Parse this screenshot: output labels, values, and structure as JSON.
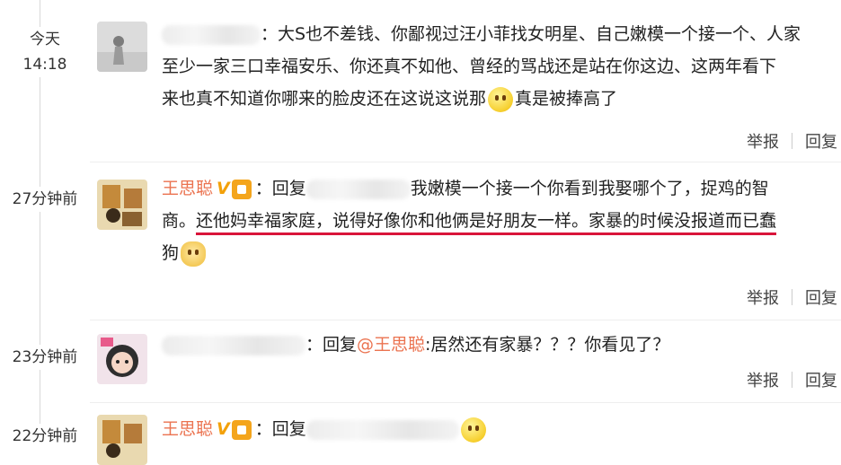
{
  "comments": [
    {
      "time": [
        "今天",
        "14:18"
      ],
      "text_lines": [
        "：大S也不差钱、你鄙视过汪小菲找女明星、自己嫩模一个接一个、人家",
        "至少一家三口幸福安乐、你还真不如他、曾经的骂战还是站在你这边、这两年看下",
        "来也真不知道你哪来的脸皮还在这说这说那",
        "真是被捧高了"
      ],
      "actions": [
        "举报",
        "回复"
      ]
    },
    {
      "time": [
        "27分钟前"
      ],
      "username": "王思聪",
      "vip": "V",
      "reply_prefix": "：回复",
      "text_lines": [
        "我嫩模一个接一个你看到我娶哪个了，捉鸡的智",
        "商。",
        "还他妈幸福家庭，说得好像你和他俩是好朋友一样。家暴的时候没报道而已蠢",
        "狗"
      ],
      "actions": [
        "举报",
        "回复"
      ]
    },
    {
      "time": [
        "23分钟前"
      ],
      "text_lines": [
        "：回复",
        "@王思聪",
        ":居然还有家暴？？？你看见了？"
      ],
      "actions": [
        "举报",
        "回复"
      ]
    },
    {
      "time": [
        "22分钟前"
      ],
      "username": "王思聪",
      "vip": "V",
      "reply_prefix": "：回复"
    }
  ],
  "colors": {
    "username": "#eb7350",
    "mention": "#eb7350",
    "underline": "#d9143a",
    "vip": "#f3a10a"
  },
  "icons": {
    "vip_badge": "verified-v-icon",
    "member_badge": "member-badge-icon",
    "emoji_1": "smirk-emoji-icon",
    "emoji_2": "dog-emoji-icon",
    "emoji_3": "shocked-emoji-icon"
  }
}
